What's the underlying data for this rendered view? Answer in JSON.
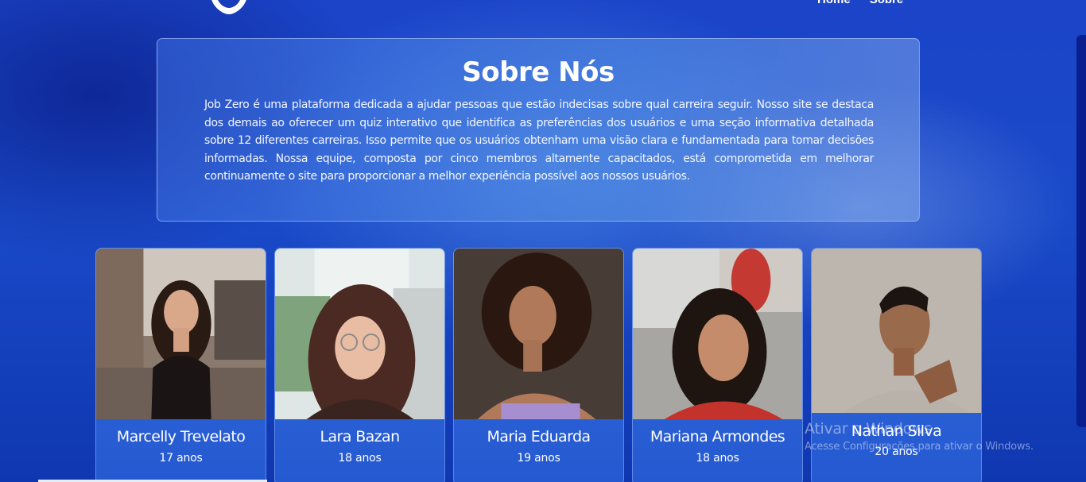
{
  "nav": {
    "items": [
      "Home",
      "Sobre"
    ]
  },
  "about": {
    "title": "Sobre Nós",
    "text": "Job Zero é uma plataforma dedicada a ajudar pessoas que estão indecisas sobre qual carreira seguir. Nosso site se destaca dos demais ao oferecer um quiz interativo que identifica as preferências dos usuários e uma seção informativa detalhada sobre 12 diferentes carreiras. Isso permite que os usuários obtenham uma visão clara e fundamentada para tomar decisões informadas. Nossa equipe, composta por cinco membros altamente capacitados, está comprometida em melhorar continuamente o site para proporcionar a melhor experiência possível aos nossos usuários."
  },
  "team": [
    {
      "name": "Marcelly Trevelato",
      "age": "17 anos"
    },
    {
      "name": "Lara Bazan",
      "age": "18 anos"
    },
    {
      "name": "Maria Eduarda",
      "age": "19 anos"
    },
    {
      "name": "Mariana Armondes",
      "age": "18 anos"
    },
    {
      "name": "Nathan Silva",
      "age": "20 anos"
    }
  ],
  "watermark": {
    "title": "Ativar o Windows",
    "subtitle": "Acesse Configurações para ativar o Windows."
  },
  "colors": {
    "background": "#1b44c8",
    "text": "#ffffff"
  }
}
